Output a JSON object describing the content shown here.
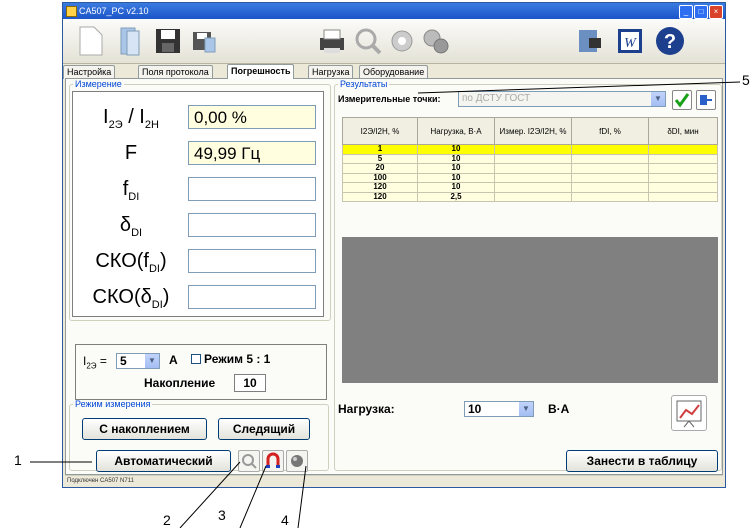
{
  "window": {
    "title": "CA507_PC v2.10"
  },
  "tabs": [
    "Настройка",
    "Поля протокола",
    "Погрешность",
    "Нагрузка",
    "Оборудование"
  ],
  "measurement": {
    "legend": "Измерение",
    "rows": [
      {
        "label": "I2Э / I2Н",
        "value": "0,00 %"
      },
      {
        "label": "F",
        "value": "49,99 Гц"
      },
      {
        "label": "fDI",
        "value": ""
      },
      {
        "label": "δDI",
        "value": ""
      },
      {
        "label": "СКО(fDI)",
        "value": ""
      },
      {
        "label": "СКО(δDI)",
        "value": ""
      }
    ],
    "current_label": "I2Э =",
    "current_value": "5",
    "current_unit": "А",
    "mode_checkbox": "Режим 5 : 1",
    "accumulation_label": "Накопление",
    "accumulation_value": "10"
  },
  "mode": {
    "legend": "Режим измерения",
    "btn_accum": "С накоплением",
    "btn_follow": "Следящий",
    "btn_auto": "Автоматический"
  },
  "results": {
    "legend": "Результаты",
    "points_label": "Измерительные точки:",
    "points_value": "по ДСТУ ГОСТ",
    "columns": [
      "I2Э/I2Н, %",
      "Нагрузка, В·А",
      "Измер. I2Э/I2Н, %",
      "fDI, %",
      "δDI, мин"
    ],
    "rows": [
      [
        "1",
        "10"
      ],
      [
        "5",
        "10"
      ],
      [
        "20",
        "10"
      ],
      [
        "100",
        "10"
      ],
      [
        "120",
        "10"
      ],
      [
        "120",
        "2,5"
      ]
    ],
    "load_label": "Нагрузка:",
    "load_value": "10",
    "load_unit": "В·А",
    "to_table_btn": "Занести в таблицу"
  },
  "status": "Подключен CA507 N711",
  "callouts": [
    "1",
    "2",
    "3",
    "4",
    "5"
  ],
  "colors": {
    "highlight": "#ffff00",
    "cell": "#ffffe0",
    "grid": "#808080",
    "title": "#1b55c9"
  }
}
